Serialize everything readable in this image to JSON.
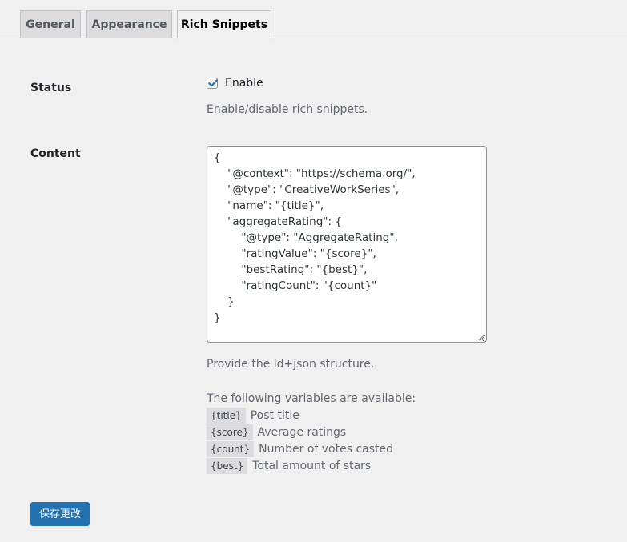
{
  "tabs": [
    {
      "label": "General"
    },
    {
      "label": "Appearance"
    },
    {
      "label": "Rich Snippets"
    }
  ],
  "status": {
    "label": "Status",
    "checkbox_label": "Enable",
    "checked": true,
    "description": "Enable/disable rich snippets."
  },
  "content": {
    "label": "Content",
    "value": "{\n    \"@context\": \"https://schema.org/\",\n    \"@type\": \"CreativeWorkSeries\",\n    \"name\": \"{title}\",\n    \"aggregateRating\": {\n        \"@type\": \"AggregateRating\",\n        \"ratingValue\": \"{score}\",\n        \"bestRating\": \"{best}\",\n        \"ratingCount\": \"{count}\"\n    }\n}",
    "description": "Provide the ld+json structure.",
    "variables_intro": "The following variables are available:",
    "variables": [
      {
        "code": "{title}",
        "desc": "Post title"
      },
      {
        "code": "{score}",
        "desc": "Average ratings"
      },
      {
        "code": "{count}",
        "desc": "Number of votes casted"
      },
      {
        "code": "{best}",
        "desc": "Total amount of stars"
      }
    ]
  },
  "save_button_label": "保存更改",
  "colors": {
    "primary": "#2271b1",
    "background": "#f0f0f1",
    "checkmark": "#2271b1"
  }
}
